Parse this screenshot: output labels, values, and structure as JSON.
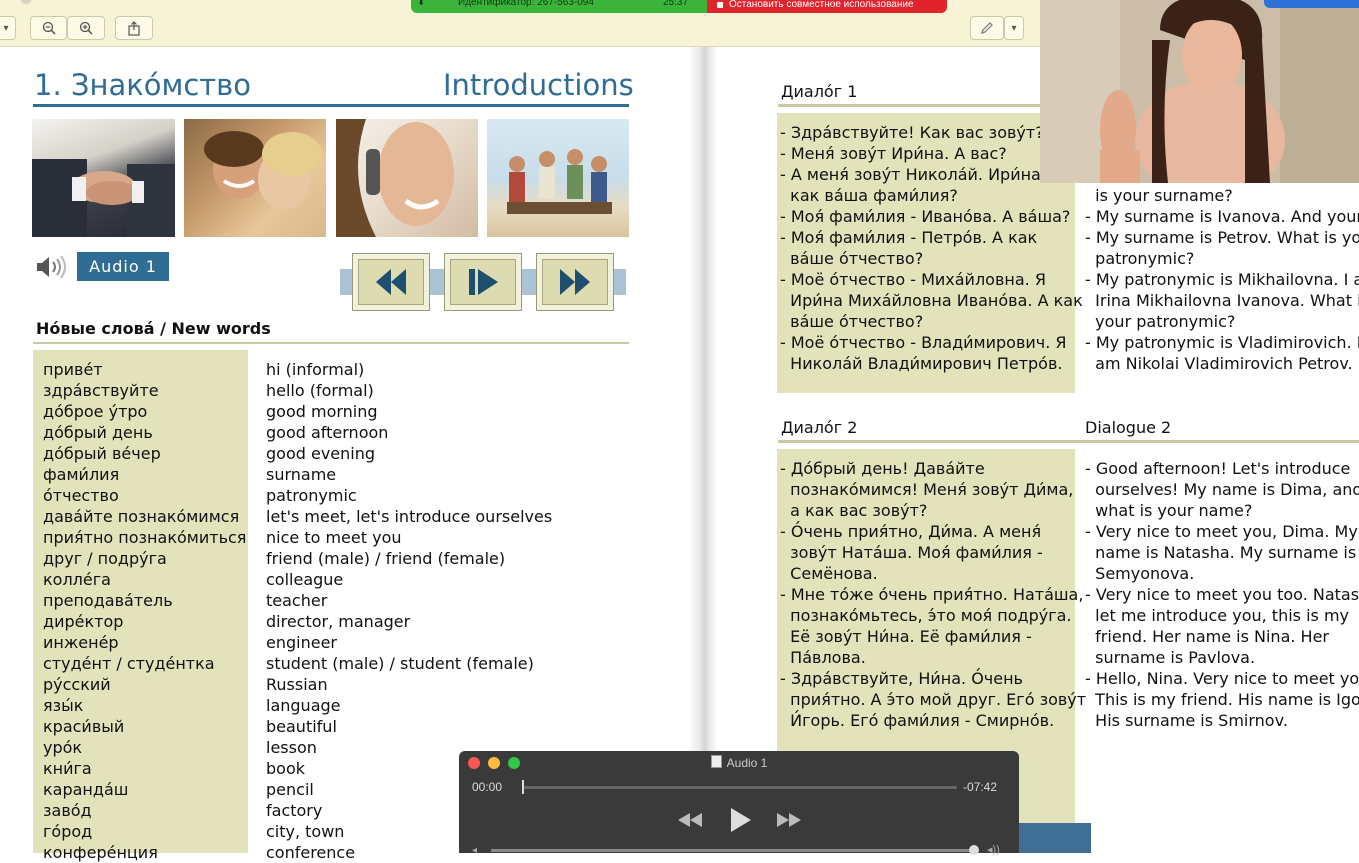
{
  "share_bar": {
    "identifier": "Идентификатор: 267-563-094",
    "timer": "25:37",
    "stop_label": "Остановить совместное использование"
  },
  "video_overlay": {
    "badge": ""
  },
  "left_page": {
    "title_ru": "1. Знако́мство",
    "title_en": "Introductions",
    "audio_label": "Audio 1",
    "new_words_heading": "Но́вые слова́ / New words",
    "words": [
      {
        "ru": "приве́т",
        "en": "hi (informal)"
      },
      {
        "ru": "здра́вствуйте",
        "en": "hello (formal)"
      },
      {
        "ru": "до́брое у́тро",
        "en": "good morning"
      },
      {
        "ru": "до́брый день",
        "en": "good afternoon"
      },
      {
        "ru": "до́брый ве́чер",
        "en": "good evening"
      },
      {
        "ru": "фами́лия",
        "en": "surname"
      },
      {
        "ru": "о́тчество",
        "en": "patronymic"
      },
      {
        "ru": "дава́йте познако́мимся",
        "en": "let's meet, let's introduce ourselves"
      },
      {
        "ru": "прия́тно познако́миться",
        "en": "nice to meet you"
      },
      {
        "ru": "друг / подру́га",
        "en": "friend (male) / friend (female)"
      },
      {
        "ru": "колле́га",
        "en": "colleague"
      },
      {
        "ru": "преподава́тель",
        "en": "teacher"
      },
      {
        "ru": "дире́ктор",
        "en": "director, manager"
      },
      {
        "ru": "инжене́р",
        "en": "engineer"
      },
      {
        "ru": "студе́нт / студе́нтка",
        "en": "student (male) / student (female)"
      },
      {
        "ru": "ру́сский",
        "en": "Russian"
      },
      {
        "ru": "язы́к",
        "en": "language"
      },
      {
        "ru": "краси́вый",
        "en": "beautiful"
      },
      {
        "ru": "уро́к",
        "en": "lesson"
      },
      {
        "ru": "кни́га",
        "en": "book"
      },
      {
        "ru": "каранда́ш",
        "en": "pencil"
      },
      {
        "ru": "заво́д",
        "en": "factory"
      },
      {
        "ru": "го́род",
        "en": "city, town"
      },
      {
        "ru": "конфере́нция",
        "en": "conference"
      }
    ]
  },
  "right_page": {
    "dialog1": {
      "heading_ru": "Диало́г 1",
      "ru_lines": [
        "- Здра́вствуйте! Как вас зову́т?",
        "- Меня́ зову́т Ири́на. А вас?",
        "- А меня́ зову́т Никола́й. Ири́на, а",
        "  как ва́ша фами́лия?",
        "- Моя́ фами́лия - Ивано́ва. А ва́ша?",
        "- Моя́ фами́лия - Петро́в. А как",
        "  ва́ше о́тчество?",
        "- Моё о́тчество - Миха́йловна. Я",
        "  Ири́на Миха́йловна Ивано́ва. А как",
        "  ва́ше о́тчество?",
        "- Моё о́тчество - Влади́мирович. Я",
        "  Никола́й Влади́мирович Петро́в."
      ],
      "en_lines": [
        "  is your surname?",
        "- My surname is Ivanova. And yours?",
        "- My surname is Petrov. What is your",
        "  patronymic?",
        "- My patronymic is Mikhailovna. I am",
        "  Irina Mikhailovna Ivanova. What is",
        "  your patronymic?",
        "- My patronymic is Vladimirovich. I",
        "  am Nikolai Vladimirovich Petrov."
      ]
    },
    "dialog2": {
      "heading_ru": "Диало́г 2",
      "heading_en": "Dialogue 2",
      "ru_lines": [
        "- До́брый день! Дава́йте",
        "  познако́мимся! Меня́ зову́т Ди́ма,",
        "  а как вас зову́т?",
        "- О́чень прия́тно, Ди́ма. А меня́",
        "  зову́т Ната́ша. Моя́ фами́лия -",
        "  Семёнова.",
        "- Мне то́же о́чень прия́тно. Ната́ша,",
        "  познако́мьтесь, э́то моя́ подру́га.",
        "  Её зову́т Ни́на. Её фами́лия -",
        "  Па́влова.",
        "- Здра́вствуйте, Ни́на. О́чень",
        "  прия́тно. А э́то мой друг. Его́ зову́т",
        "  И́горь. Его́ фами́лия - Смирно́в."
      ],
      "en_lines": [
        "- Good afternoon! Let's introduce",
        "  ourselves! My name is Dima, and",
        "  what is your name?",
        "- Very nice to meet you, Dima. My",
        "  name is Natasha. My surname is",
        "  Semyonova.",
        "- Very nice to meet you too. Natasha,",
        "  let me introduce you, this is my",
        "  friend. Her name is Nina. Her",
        "  surname is Pavlova.",
        "- Hello, Nina. Very nice to meet you.",
        "  This is my friend. His name is Igor.",
        "  His surname is Smirnov."
      ]
    }
  },
  "player": {
    "title": "Audio 1",
    "current_time": "00:00",
    "remaining_time": "-07:42",
    "progress": 0.0
  },
  "colors": {
    "accent_blue": "#2f6d95",
    "highlight_box": "#e2e2bb",
    "toolbar_bg": "#f6f4d5"
  }
}
